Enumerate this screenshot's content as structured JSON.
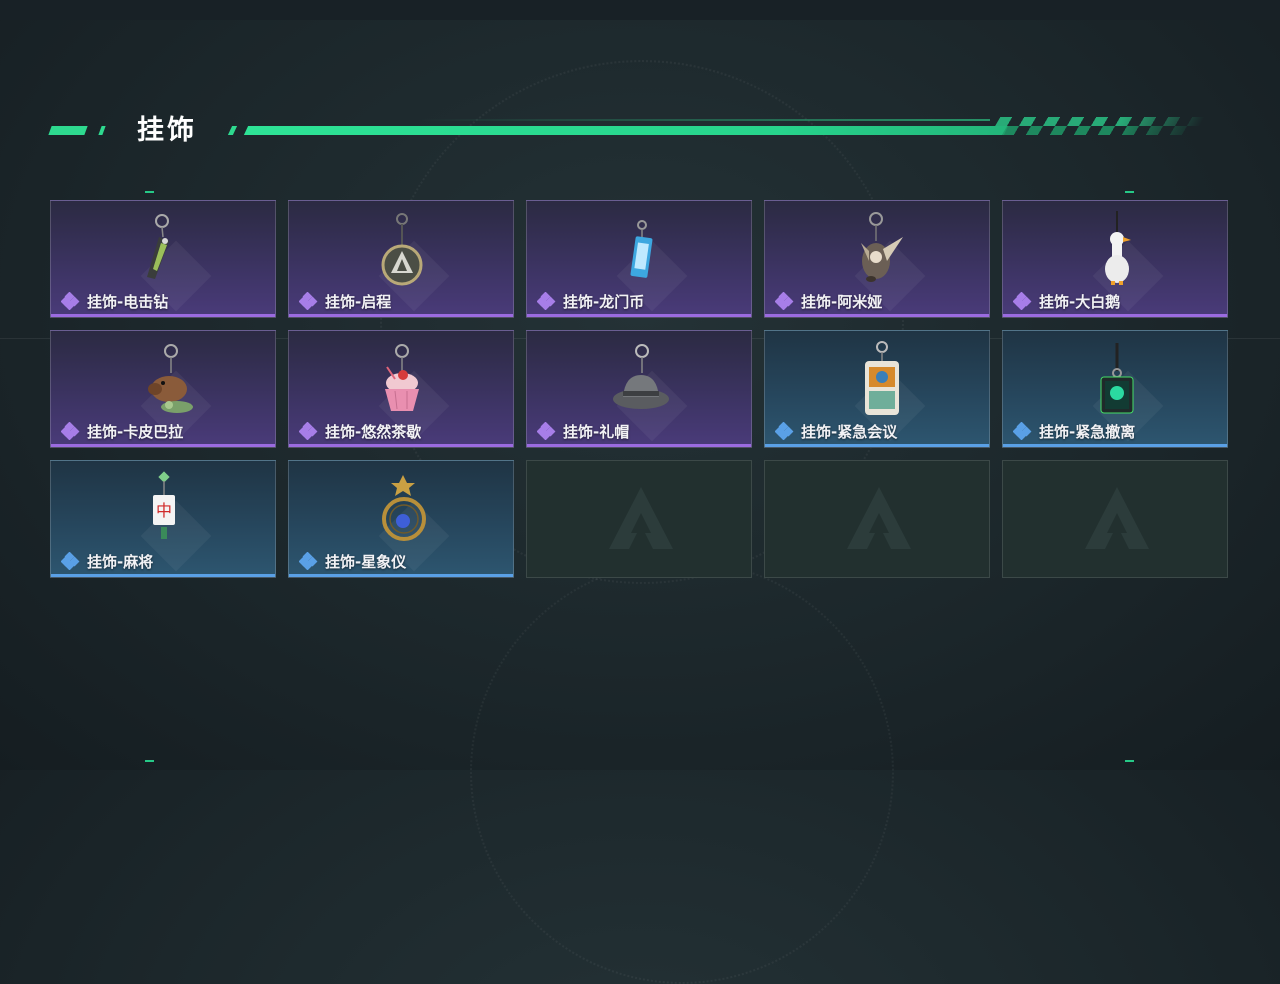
{
  "section": {
    "title": "挂饰"
  },
  "colors": {
    "accent": "#2ed98f",
    "rare_purple": "#9b6be0",
    "rare_blue": "#5aa0e6"
  },
  "items": [
    {
      "label": "挂饰-电击钻",
      "rarity": "purple",
      "icon": "drill-charm-icon"
    },
    {
      "label": "挂饰-启程",
      "rarity": "purple",
      "icon": "medallion-charm-icon"
    },
    {
      "label": "挂饰-龙门币",
      "rarity": "purple",
      "icon": "card-charm-icon"
    },
    {
      "label": "挂饰-阿米娅",
      "rarity": "purple",
      "icon": "bunny-charm-icon"
    },
    {
      "label": "挂饰-大白鹅",
      "rarity": "purple",
      "icon": "goose-charm-icon"
    },
    {
      "label": "挂饰-卡皮巴拉",
      "rarity": "purple",
      "icon": "capybara-charm-icon"
    },
    {
      "label": "挂饰-悠然茶歇",
      "rarity": "purple",
      "icon": "cupcake-charm-icon"
    },
    {
      "label": "挂饰-礼帽",
      "rarity": "purple",
      "icon": "hat-charm-icon"
    },
    {
      "label": "挂饰-紧急会议",
      "rarity": "blue",
      "icon": "badge-charm-icon"
    },
    {
      "label": "挂饰-紧急撤离",
      "rarity": "blue",
      "icon": "tag-charm-icon"
    },
    {
      "label": "挂饰-麻将",
      "rarity": "blue",
      "icon": "mahjong-charm-icon"
    },
    {
      "label": "挂饰-星象仪",
      "rarity": "blue",
      "icon": "astrolabe-charm-icon"
    }
  ],
  "empty_slots": 3
}
